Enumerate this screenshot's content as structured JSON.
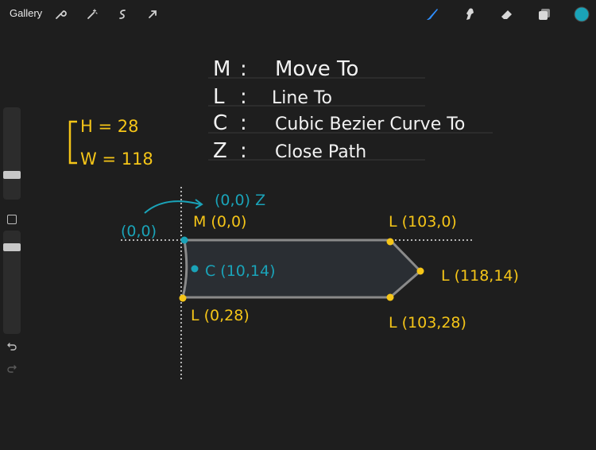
{
  "topbar": {
    "gallery_label": "Gallery",
    "left_tools": [
      "wrench-icon",
      "magic-wand-icon",
      "selection-icon",
      "transform-arrow-icon"
    ],
    "right_tools": [
      "brush-icon",
      "smudge-icon",
      "eraser-icon",
      "layers-icon",
      "color-icon"
    ],
    "active_color": "#1aa3b8",
    "accent_color": "#2f8fff"
  },
  "legend": {
    "lines": [
      {
        "key": "M",
        "sep": ":",
        "text": "Move To"
      },
      {
        "key": "L",
        "sep": ":",
        "text": "Line To"
      },
      {
        "key": "C",
        "sep": ":",
        "text": "Cubic Bezier Curve To"
      },
      {
        "key": "Z",
        "sep": ":",
        "text": "Close Path"
      }
    ]
  },
  "dimensions": {
    "height": "H = 28",
    "width": "W = 118"
  },
  "annotations": {
    "origin": "(0,0)",
    "close": "(0,0) Z",
    "move": "M (0,0)",
    "curve": "C (10,14)",
    "top_right": "L (103,0)",
    "tip": "L (118,14)",
    "bottom_right": "L (103,28)",
    "bottom_left": "L (0,28)"
  },
  "colors": {
    "yellow": "#f5c518",
    "teal": "#1aa3b8",
    "white": "#f2f2f2",
    "shape_fill": "#2a2e33",
    "shape_stroke": "#8a8a8a"
  }
}
